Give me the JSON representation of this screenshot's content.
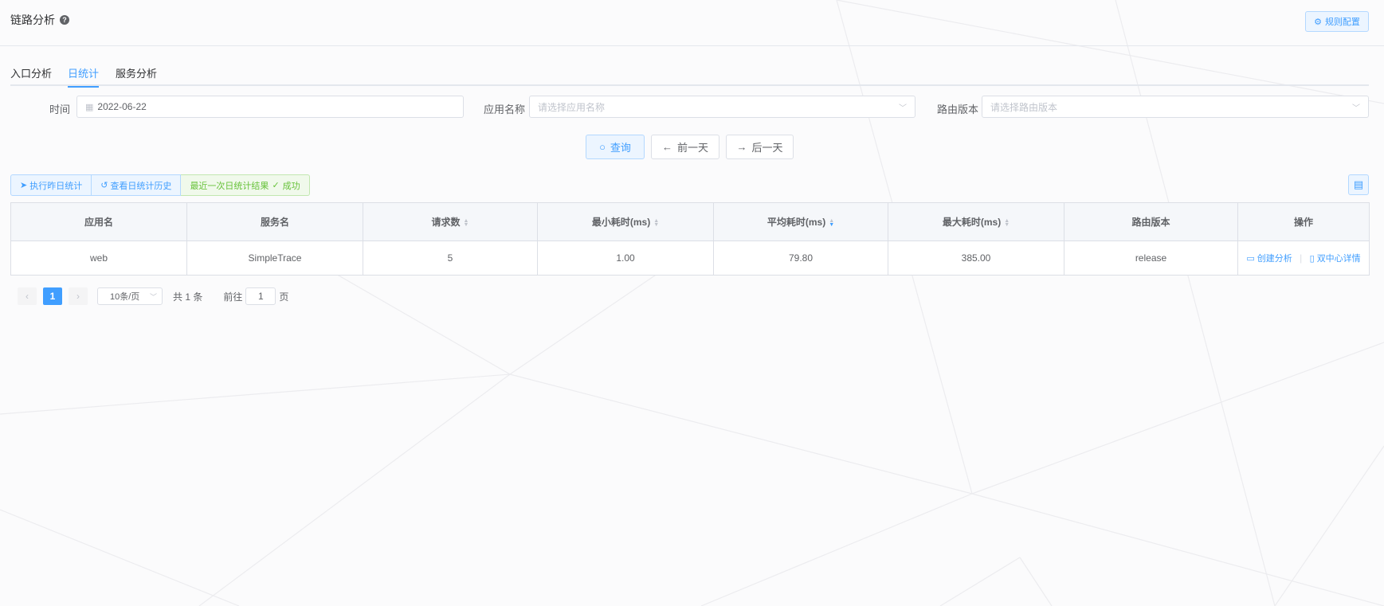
{
  "header": {
    "title": "链路分析",
    "rules_button": "规则配置"
  },
  "tabs": [
    {
      "label": "入口分析",
      "active": false
    },
    {
      "label": "日统计",
      "active": true
    },
    {
      "label": "服务分析",
      "active": false
    }
  ],
  "filters": {
    "time_label": "时间",
    "time_value": "2022-06-22",
    "app_label": "应用名称",
    "app_placeholder": "请选择应用名称",
    "route_label": "路由版本",
    "route_placeholder": "请选择路由版本"
  },
  "actions": {
    "query": "查询",
    "prev_day": "前一天",
    "next_day": "后一天"
  },
  "toolbar": {
    "run_yesterday": "执行昨日统计",
    "view_history": "查看日统计历史",
    "last_result": "最近一次日统计结果",
    "last_status": "成功"
  },
  "table": {
    "headers": [
      "应用名",
      "服务名",
      "请求数",
      "最小耗时(ms)",
      "平均耗时(ms)",
      "最大耗时(ms)",
      "路由版本",
      "操作"
    ],
    "rows": [
      {
        "app": "web",
        "service": "SimpleTrace",
        "requests": "5",
        "min": "1.00",
        "avg": "79.80",
        "max": "385.00",
        "route": "release"
      }
    ],
    "ops": {
      "create_analysis": "创建分析",
      "dual_center": "双中心详情"
    }
  },
  "pagination": {
    "current_page": "1",
    "page_size": "10条/页",
    "total": "共 1 条",
    "goto_label": "前往",
    "goto_value": "1",
    "page_unit": "页"
  },
  "colors": {
    "accent": "#409eff",
    "success": "#67c23a",
    "border": "#dcdfe6"
  }
}
